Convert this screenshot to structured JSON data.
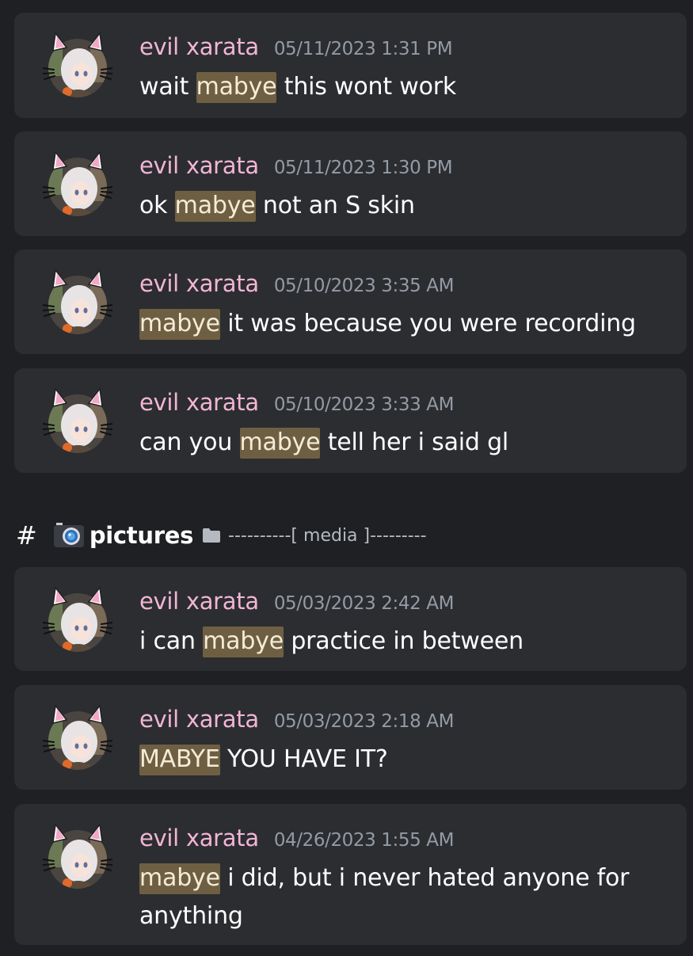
{
  "messages_group_1": [
    {
      "author": "evil xarata",
      "timestamp": "05/11/2023 1:31 PM",
      "segments": [
        {
          "text": "wait ",
          "highlight": false
        },
        {
          "text": "mabye",
          "highlight": true
        },
        {
          "text": " this wont work",
          "highlight": false
        }
      ]
    },
    {
      "author": "evil xarata",
      "timestamp": "05/11/2023 1:30 PM",
      "segments": [
        {
          "text": "ok ",
          "highlight": false
        },
        {
          "text": "mabye",
          "highlight": true
        },
        {
          "text": " not an S skin",
          "highlight": false
        }
      ]
    },
    {
      "author": "evil xarata",
      "timestamp": "05/10/2023 3:35 AM",
      "segments": [
        {
          "text": "mabye",
          "highlight": true
        },
        {
          "text": " it was because you were recording",
          "highlight": false
        }
      ]
    },
    {
      "author": "evil xarata",
      "timestamp": "05/10/2023 3:33 AM",
      "segments": [
        {
          "text": "can you ",
          "highlight": false
        },
        {
          "text": "mabye",
          "highlight": true
        },
        {
          "text": " tell her i said gl",
          "highlight": false
        }
      ]
    }
  ],
  "channel": {
    "hash": "#",
    "name": "pictures",
    "category": "----------[ media ]---------",
    "icon": "camera-icon",
    "category_icon": "folder-icon"
  },
  "messages_group_2": [
    {
      "author": "evil xarata",
      "timestamp": "05/03/2023 2:42 AM",
      "segments": [
        {
          "text": "i can ",
          "highlight": false
        },
        {
          "text": "mabye",
          "highlight": true
        },
        {
          "text": " practice in between",
          "highlight": false
        }
      ]
    },
    {
      "author": "evil xarata",
      "timestamp": "05/03/2023 2:18 AM",
      "segments": [
        {
          "text": "MABYE",
          "highlight": true
        },
        {
          "text": " YOU HAVE IT?",
          "highlight": false
        }
      ]
    },
    {
      "author": "evil xarata",
      "timestamp": "04/26/2023 1:55 AM",
      "segments": [
        {
          "text": "mabye",
          "highlight": true
        },
        {
          "text": " i did, but i never hated anyone for anything",
          "highlight": false
        }
      ]
    }
  ],
  "colors": {
    "background": "#1f2024",
    "card": "#2b2d31",
    "author": "#f2b5d4",
    "timestamp": "#949ba4",
    "highlight": "#6f5f42",
    "message_text": "#ffffff"
  }
}
